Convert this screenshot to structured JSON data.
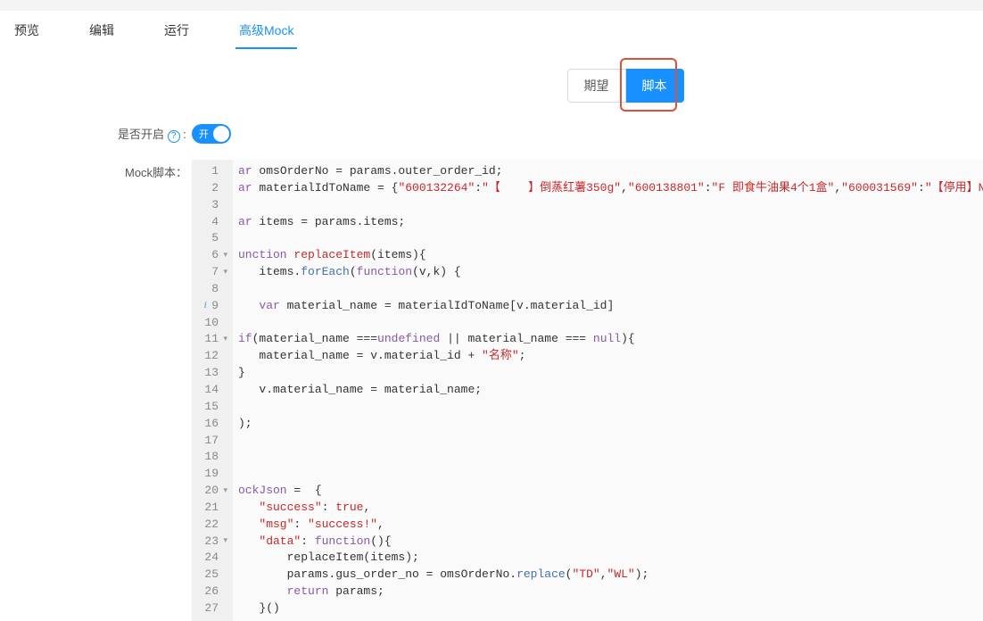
{
  "tabs": {
    "preview": "预览",
    "edit": "编辑",
    "run": "运行",
    "advanced": "高级Mock"
  },
  "segmented": {
    "expect": "期望",
    "script": "脚本"
  },
  "enable": {
    "label": "是否开启",
    "toggle_text": "开"
  },
  "script": {
    "label": "Mock脚本："
  },
  "code": {
    "lines": [
      {
        "n": "1",
        "fold": "",
        "html": "<span class='kw'>ar</span> omsOrderNo = params.outer_order_id;"
      },
      {
        "n": "2",
        "fold": "",
        "html": "<span class='kw'>ar</span> materialIdToName = {<span class='str'>\"600132264\"</span>:<span class='str'>\"【    】倒蒸红薯350g\"</span>,<span class='str'>\"600138801\"</span>:<span class='str'>\"F 即食牛油果4个1盒\"</span>,<span class='str'>\"600031569\"</span>:<span class='str'>\"【停用】N</span>"
      },
      {
        "n": "3",
        "fold": "",
        "html": ""
      },
      {
        "n": "4",
        "fold": "",
        "html": "<span class='kw'>ar</span> items = params.items;"
      },
      {
        "n": "5",
        "fold": "",
        "html": ""
      },
      {
        "n": "6",
        "fold": "▾",
        "html": "<span class='kw'>unction</span> <span class='fnName'>replaceItem</span>(items){"
      },
      {
        "n": "7",
        "fold": "▾",
        "html": "   items.<span class='fn'>forEach</span>(<span class='kw'>function</span>(v,k) {"
      },
      {
        "n": "8",
        "fold": "",
        "html": ""
      },
      {
        "n": "9",
        "fold": "",
        "info": true,
        "html": "   <span class='kw'>var</span> material_name = materialIdToName[v.material_id]"
      },
      {
        "n": "10",
        "fold": "",
        "html": ""
      },
      {
        "n": "11",
        "fold": "▾",
        "html": "<span class='kw'>if</span>(material_name ===<span class='kw'>undefined</span> || material_name === <span class='kw'>null</span>){"
      },
      {
        "n": "12",
        "fold": "",
        "html": "   material_name = v.material_id + <span class='str'>\"名称\"</span>;"
      },
      {
        "n": "13",
        "fold": "",
        "html": "}"
      },
      {
        "n": "14",
        "fold": "",
        "html": "   v.material_name = material_name;"
      },
      {
        "n": "15",
        "fold": "",
        "html": ""
      },
      {
        "n": "16",
        "fold": "",
        "html": ");"
      },
      {
        "n": "17",
        "fold": "",
        "html": ""
      },
      {
        "n": "18",
        "fold": "",
        "html": ""
      },
      {
        "n": "19",
        "fold": "",
        "html": ""
      },
      {
        "n": "20",
        "fold": "▾",
        "html": "<span class='kw'>ockJson</span> =  {"
      },
      {
        "n": "21",
        "fold": "",
        "html": "   <span class='prop'>\"success\"</span>: <span class='bool'>true</span>,"
      },
      {
        "n": "22",
        "fold": "",
        "html": "   <span class='prop'>\"msg\"</span>: <span class='str'>\"success!\"</span>,"
      },
      {
        "n": "23",
        "fold": "▾",
        "html": "   <span class='prop'>\"data\"</span>: <span class='kw'>function</span>(){"
      },
      {
        "n": "24",
        "fold": "",
        "html": "       replaceItem(items);"
      },
      {
        "n": "25",
        "fold": "",
        "html": "       params.gus_order_no = omsOrderNo.<span class='fn'>replace</span>(<span class='str'>\"TD\"</span>,<span class='str'>\"WL\"</span>);"
      },
      {
        "n": "26",
        "fold": "",
        "html": "       <span class='kw'>return</span> params;"
      },
      {
        "n": "27",
        "fold": "",
        "html": "   }()"
      }
    ]
  }
}
